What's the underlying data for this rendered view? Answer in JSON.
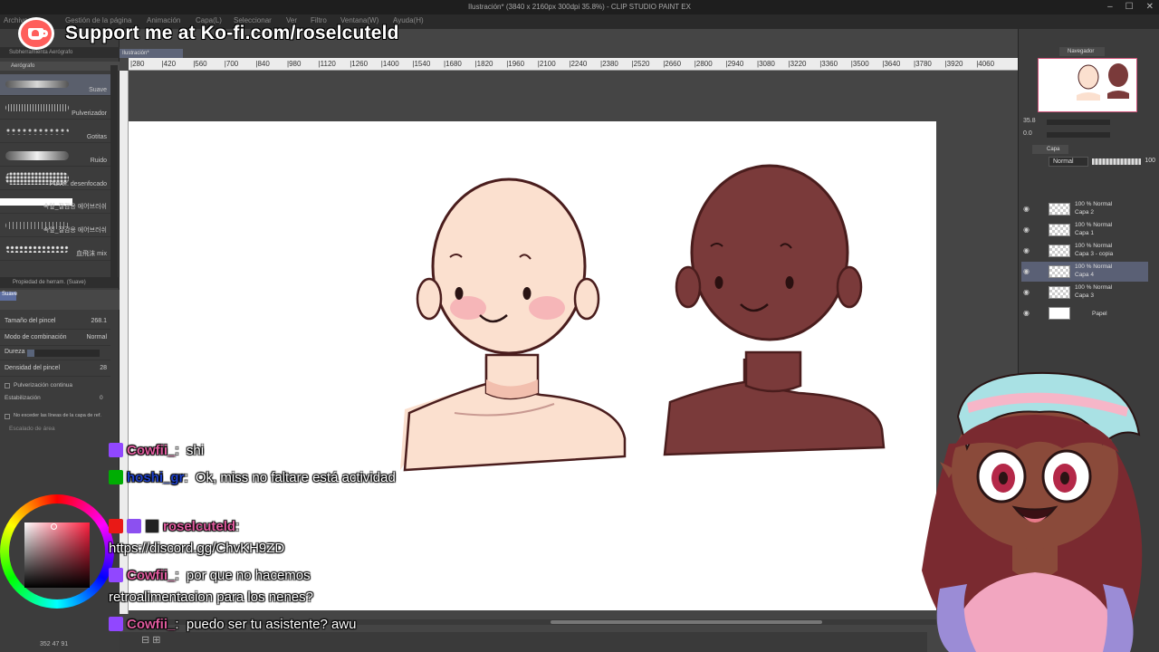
{
  "window": {
    "title": "Ilustración* (3840 x 2160px 300dpi 35.8%) - CLIP STUDIO PAINT EX",
    "controls": [
      "–",
      "☐",
      "✕"
    ]
  },
  "menu": [
    "Archivo",
    "Gestión de la página",
    "Animación",
    "Capa(L)",
    "Seleccionar",
    "Ver",
    "Filtro",
    "Ventana(W)",
    "Ayuda(H)"
  ],
  "overlay": {
    "kofi_text": "Support me at Ko-fi.com/roselcuteld"
  },
  "doc_tab": "Ilustración*",
  "tool_panel": {
    "tab": "Subherramienta Aerógrafo",
    "group": "Aerógrafo",
    "brushes": [
      {
        "name": "Suave",
        "selected": true
      },
      {
        "name": "Pulverizador",
        "selected": false
      },
      {
        "name": "Gotitas",
        "selected": false
      },
      {
        "name": "Ruido",
        "selected": false
      },
      {
        "name": "Pulver. desenfocado",
        "selected": false
      },
      {
        "name": "속잎_질감용 에어브러쉬",
        "selected": false
      },
      {
        "name": "속잎_질감용 에어브러쉬",
        "selected": false
      },
      {
        "name": "血飛沫 mix",
        "selected": false
      }
    ]
  },
  "tool_property": {
    "title": "Propiedad de herram. (Suave)",
    "chip": "Suave",
    "rows": [
      {
        "label": "Tamaño del pincel",
        "value": "268.1",
        "fill": 0.27
      },
      {
        "label": "Modo de combinación",
        "value": "Normal",
        "fill": 0
      },
      {
        "label": "Dureza",
        "value": "",
        "fill": 0.1
      },
      {
        "label": "Densidad del pincel",
        "value": "28",
        "fill": 0.28
      }
    ],
    "checks": [
      "Pulverización continua",
      "No exceder las líneas de la capa de ref."
    ],
    "stabilization": {
      "label": "Estabilización",
      "value": "0"
    },
    "area_scale": "Escalado de área"
  },
  "status_left": "352  47  91",
  "ruler_ticks": [
    "280",
    "420",
    "560",
    "700",
    "840",
    "980",
    "1120",
    "1260",
    "1400",
    "1540",
    "1680",
    "1820",
    "1960",
    "2100",
    "2240",
    "2380",
    "2520",
    "2660",
    "2800",
    "2940",
    "3080",
    "3220",
    "3360",
    "3500",
    "3640",
    "3780",
    "3920",
    "4060"
  ],
  "navigator": {
    "tab": "Navegador",
    "zoom": "35.8",
    "rotation": "0.0"
  },
  "layers": {
    "tab": "Capa",
    "blend_mode": "Normal",
    "opacity": "100",
    "items": [
      {
        "mode": "100 % Normal",
        "name": "Capa 2",
        "selected": false,
        "plain": false
      },
      {
        "mode": "100 % Normal",
        "name": "Capa 1",
        "selected": false,
        "plain": false
      },
      {
        "mode": "100 % Normal",
        "name": "Capa 3 - copia",
        "selected": false,
        "plain": false
      },
      {
        "mode": "100 % Normal",
        "name": "Capa 4",
        "selected": true,
        "plain": false
      },
      {
        "mode": "100 % Normal",
        "name": "Capa 3",
        "selected": false,
        "plain": false
      },
      {
        "mode": "",
        "name": "Papel",
        "selected": false,
        "plain": true
      }
    ]
  },
  "chat": [
    {
      "user": "Cowfii_",
      "color": "#e05b9e",
      "badges": [
        "b23"
      ],
      "text": "shi"
    },
    {
      "user": "hoshi_gr",
      "color": "#1e40c8",
      "badges": [
        "green"
      ],
      "text": "Ok, miss no faltare está actividad"
    },
    {
      "user": "roselcuteld",
      "color": "#e05b9e",
      "badges": [
        "red",
        "purple",
        "black"
      ],
      "text": "https://discord.gg/ChvKH9ZD"
    },
    {
      "user": "Cowfii_",
      "color": "#e05b9e",
      "badges": [
        "b23"
      ],
      "text": "por que no hacemos retroalimentacion para los nenes?"
    },
    {
      "user": "Cowfii_",
      "color": "#e05b9e",
      "badges": [
        "b23"
      ],
      "text": "puedo ser tu asistente? awu"
    }
  ],
  "colors": {
    "skin_light": "#fbe0cf",
    "skin_dark": "#7a3a3a",
    "outline": "#4a1d1d",
    "blush": "#f4a4ae",
    "kofi": "#ff5e5b"
  }
}
